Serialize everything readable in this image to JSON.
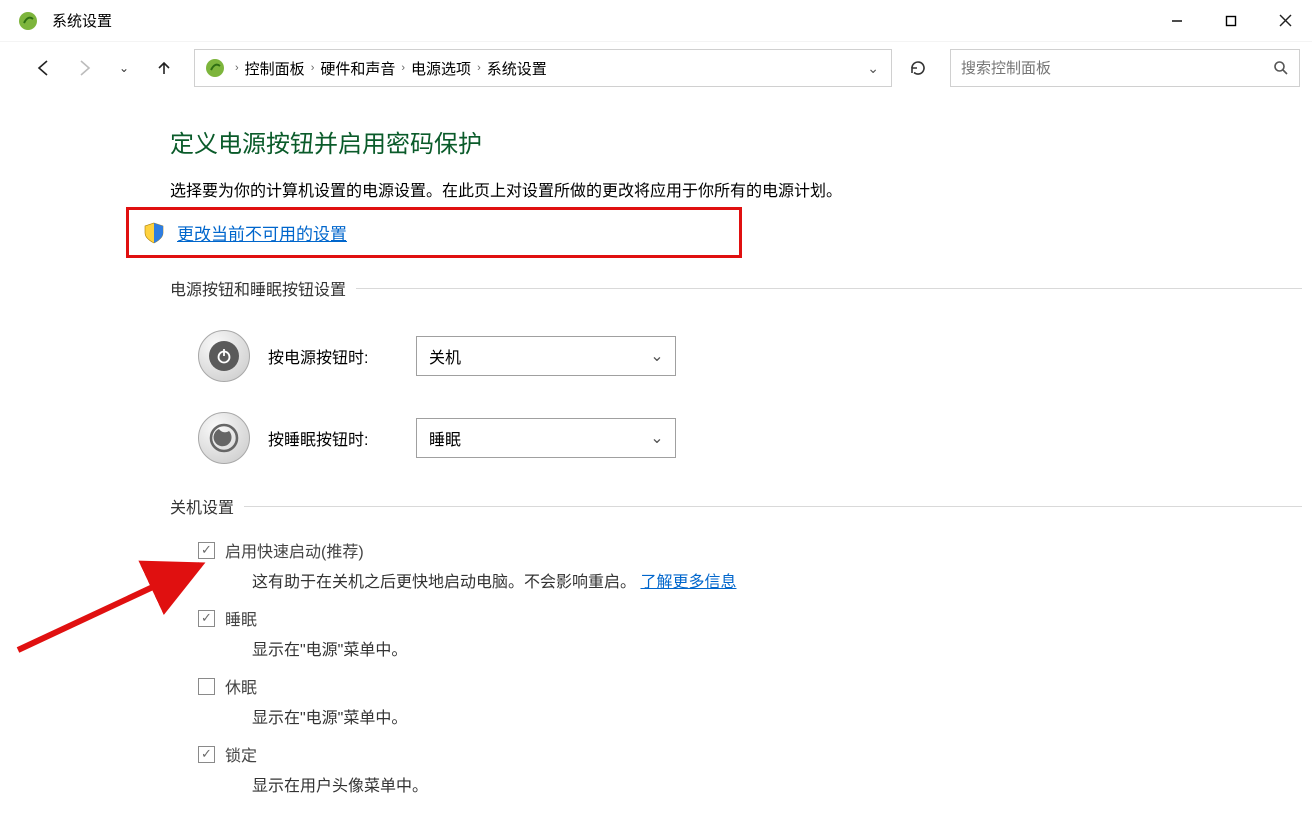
{
  "window": {
    "title": "系统设置"
  },
  "breadcrumb": {
    "items": [
      "控制面板",
      "硬件和声音",
      "电源选项",
      "系统设置"
    ]
  },
  "search": {
    "placeholder": "搜索控制面板"
  },
  "page": {
    "heading": "定义电源按钮并启用密码保护",
    "description": "选择要为你的计算机设置的电源设置。在此页上对设置所做的更改将应用于你所有的电源计划。",
    "change_link": "更改当前不可用的设置"
  },
  "power_section": {
    "header": "电源按钮和睡眠按钮设置",
    "rows": [
      {
        "label": "按电源按钮时:",
        "value": "关机"
      },
      {
        "label": "按睡眠按钮时:",
        "value": "睡眠"
      }
    ]
  },
  "shutdown_section": {
    "header": "关机设置",
    "items": [
      {
        "checked": true,
        "label": "启用快速启动(推荐)",
        "desc_prefix": "这有助于在关机之后更快地启动电脑。不会影响重启。",
        "link": "了解更多信息"
      },
      {
        "checked": true,
        "label": "睡眠",
        "desc_prefix": "显示在\"电源\"菜单中。",
        "link": ""
      },
      {
        "checked": false,
        "label": "休眠",
        "desc_prefix": "显示在\"电源\"菜单中。",
        "link": ""
      },
      {
        "checked": true,
        "label": "锁定",
        "desc_prefix": "显示在用户头像菜单中。",
        "link": ""
      }
    ]
  }
}
